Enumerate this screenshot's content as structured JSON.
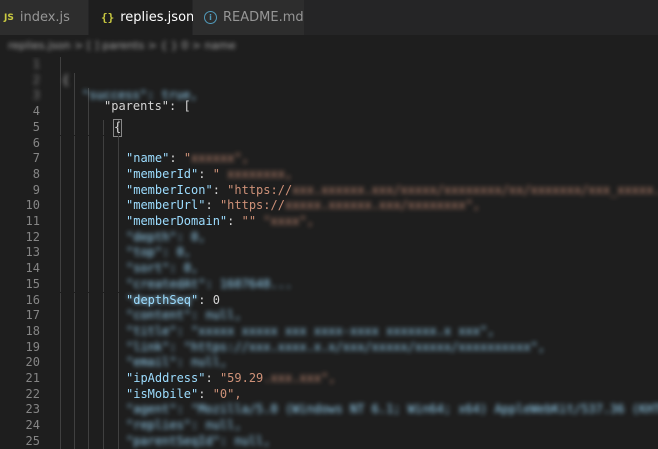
{
  "tabs": [
    {
      "label": "index.js",
      "icon": "JS",
      "active": false
    },
    {
      "label": "replies.json",
      "icon": "{}",
      "active": true,
      "close": "×"
    },
    {
      "label": "README.md",
      "icon": "i",
      "active": false
    }
  ],
  "breadcrumb": {
    "text": "replies.json > [ ] parents > { } 0 > name"
  },
  "editor": {
    "lines": [
      {
        "num": "1",
        "blur": true
      },
      {
        "num": "2",
        "blur": true
      },
      {
        "num": "3",
        "blur": true
      },
      {
        "num": "4",
        "text": "\"parents\": ["
      },
      {
        "num": "5",
        "text": "{"
      },
      {
        "num": "6",
        "blur": true
      },
      {
        "num": "7",
        "key": "\"name\"",
        "colon": ": ",
        "val": "\""
      },
      {
        "num": "8",
        "key": "\"memberId\"",
        "colon": ": ",
        "val": "\""
      },
      {
        "num": "9",
        "key": "\"memberIcon\"",
        "colon": ": ",
        "val": "\"https://"
      },
      {
        "num": "10",
        "key": "\"memberUrl\"",
        "colon": ": ",
        "val": "\"https://"
      },
      {
        "num": "11",
        "key": "\"memberDomain\"",
        "colon": ": ",
        "val": "\"\""
      },
      {
        "num": "12",
        "blur": true
      },
      {
        "num": "13",
        "blur": true
      },
      {
        "num": "14",
        "blur": true
      },
      {
        "num": "15",
        "blur": true
      },
      {
        "num": "16",
        "key": "\"depthSeq\"",
        "colon": ": ",
        "val": "0"
      },
      {
        "num": "17",
        "blur": true
      },
      {
        "num": "18",
        "blur": true
      },
      {
        "num": "19",
        "blur": true
      },
      {
        "num": "20",
        "blur": true
      },
      {
        "num": "21",
        "key": "\"ipAddress\"",
        "colon": ": ",
        "val": "\"59.29"
      },
      {
        "num": "22",
        "key": "\"isMobile\"",
        "colon": ": ",
        "val": "\"0\","
      },
      {
        "num": "23",
        "blur": true
      },
      {
        "num": "24",
        "blur": true
      },
      {
        "num": "25",
        "blur": true
      }
    ]
  }
}
